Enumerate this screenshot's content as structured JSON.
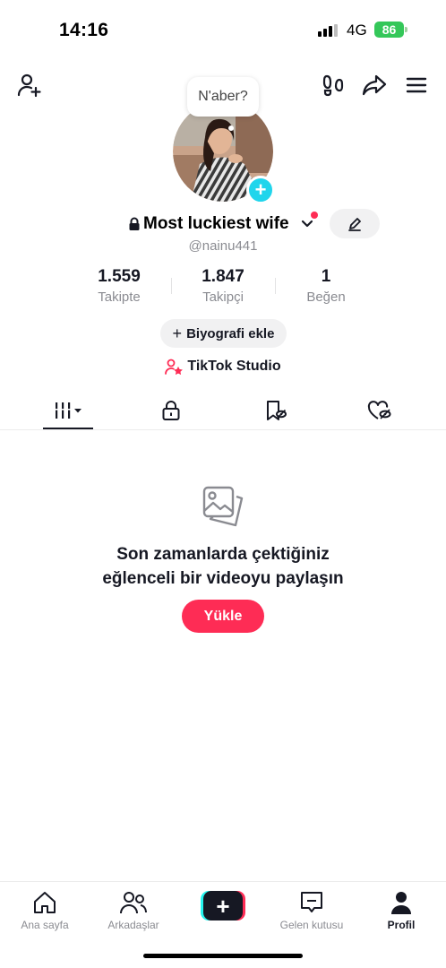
{
  "status_bar": {
    "time": "14:16",
    "network": "4G",
    "battery": "86"
  },
  "header": {
    "add_friend_icon": "person-plus-icon",
    "footprints_icon": "footprints-icon",
    "share_icon": "share-arrow-icon",
    "menu_icon": "hamburger-menu-icon"
  },
  "profile": {
    "status_bubble": "N'aber?",
    "display_name": "Most luckiest wife",
    "username": "@nainu441",
    "stats": [
      {
        "value": "1.559",
        "label": "Takipte"
      },
      {
        "value": "1.847",
        "label": "Takipçi"
      },
      {
        "value": "1",
        "label": "Beğen"
      }
    ],
    "bio_button": "Biyografi ekle",
    "bio_plus": "+",
    "studio_link": "TikTok Studio"
  },
  "empty_state": {
    "title_line1": "Son zamanlarda çektiğiniz",
    "title_line2": "eğlenceli bir videoyu paylaşın",
    "upload_button": "Yükle"
  },
  "nav": {
    "home": "Ana sayfa",
    "friends": "Arkadaşlar",
    "create": "+",
    "inbox": "Gelen kutusu",
    "profile": "Profil"
  },
  "colors": {
    "accent": "#fe2c55",
    "cyan": "#25f4ee",
    "story_plus": "#20d5ec",
    "battery": "#34c759"
  }
}
